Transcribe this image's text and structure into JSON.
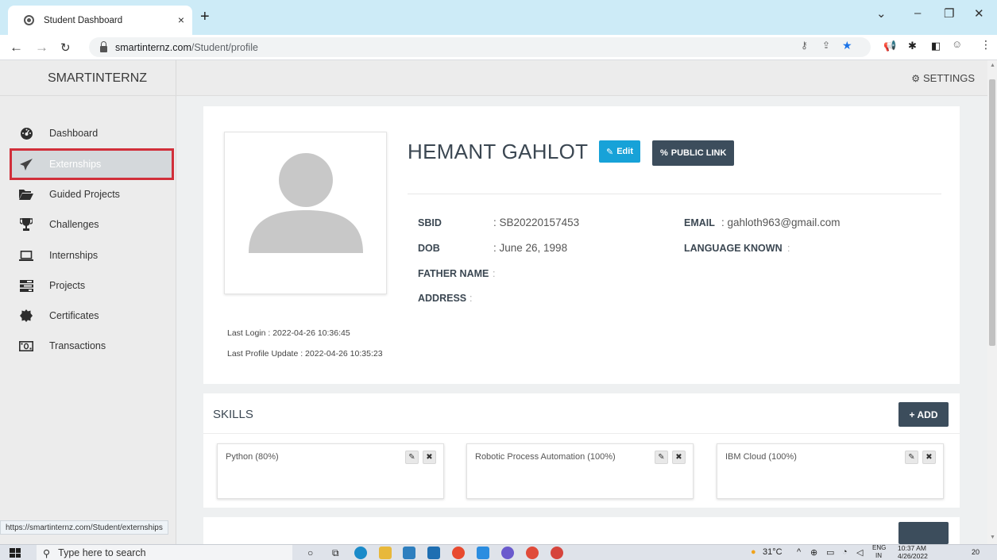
{
  "browser": {
    "tab_title": "Student Dashboard",
    "tab_close": "×",
    "new_tab": "+",
    "url_host": "smartinternz.com",
    "url_path": "/Student/profile",
    "status_url": "https://smartinternz.com/Student/externships"
  },
  "app": {
    "brand": "SMARTINTERNZ",
    "settings_label": "SETTINGS"
  },
  "sidebar": {
    "items": [
      {
        "label": "Dashboard",
        "icon": "dashboard-icon"
      },
      {
        "label": "Externships",
        "icon": "paper-plane-icon"
      },
      {
        "label": "Guided Projects",
        "icon": "folder-open-icon"
      },
      {
        "label": "Challenges",
        "icon": "trophy-icon"
      },
      {
        "label": "Internships",
        "icon": "laptop-icon"
      },
      {
        "label": "Projects",
        "icon": "tasks-icon"
      },
      {
        "label": "Certificates",
        "icon": "certificate-icon"
      },
      {
        "label": "Transactions",
        "icon": "money-icon"
      }
    ],
    "active_index": 1
  },
  "profile": {
    "name": "HEMANT GAHLOT",
    "edit_label": "Edit",
    "public_link_label": "PUBLIC LINK",
    "sbid_label": "SBID",
    "sbid_value": ": SB20220157453",
    "dob_label": "DOB",
    "dob_value": ": June 26, 1998",
    "father_label": "FATHER NAME",
    "father_value": ":",
    "address_label": "ADDRESS",
    "address_value": ":",
    "email_label": "EMAIL",
    "email_value": ": gahloth963@gmail.com",
    "language_label": "LANGUAGE KNOWN",
    "language_value": ":",
    "last_login": "Last Login : 2022-04-26 10:36:45",
    "last_update": "Last Profile Update : 2022-04-26 10:35:23"
  },
  "skills": {
    "title": "SKILLS",
    "add_label": "ADD",
    "items": [
      {
        "label": "Python (80%)"
      },
      {
        "label": "Robotic Process Automation (100%)"
      },
      {
        "label": "IBM Cloud (100%)"
      }
    ]
  },
  "taskbar": {
    "search_placeholder": "Type here to search",
    "weather": "31°C",
    "lang_top": "ENG",
    "lang_bottom": "IN",
    "time": "10:37 AM",
    "date": "4/26/2022",
    "notifications": "20"
  }
}
